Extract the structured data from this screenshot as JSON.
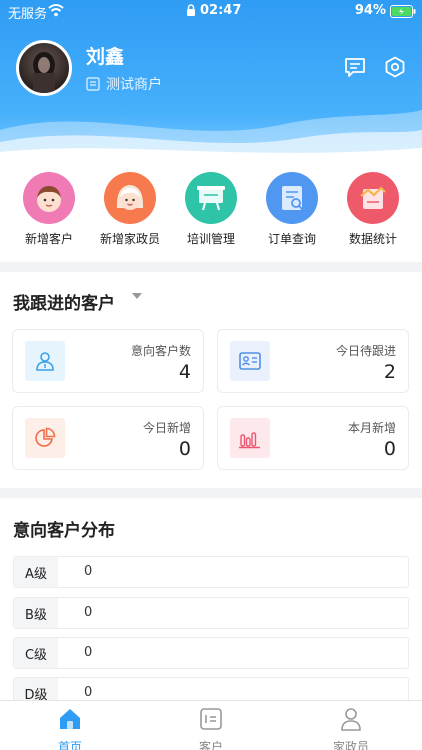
{
  "status_bar": {
    "carrier": "无服务",
    "time": "02:47",
    "battery": "94%"
  },
  "header": {
    "username": "刘鑫",
    "merchant": "测试商户"
  },
  "shortcuts": [
    {
      "label": "新增客户",
      "color": "#f07bb4"
    },
    {
      "label": "新增家政员",
      "color": "#f77a4e"
    },
    {
      "label": "培训管理",
      "color": "#2fc3a8"
    },
    {
      "label": "订单查询",
      "color": "#4f97f1"
    },
    {
      "label": "数据统计",
      "color": "#ef5a6a"
    }
  ],
  "my_customers": {
    "title": "我跟进的客户",
    "stats": [
      {
        "label": "意向客户数",
        "value": "4"
      },
      {
        "label": "今日待跟进",
        "value": "2"
      },
      {
        "label": "今日新增",
        "value": "0"
      },
      {
        "label": "本月新增",
        "value": "0"
      }
    ]
  },
  "distribution": {
    "title": "意向客户分布",
    "rows": [
      {
        "label": "A级",
        "value": "0"
      },
      {
        "label": "B级",
        "value": "0"
      },
      {
        "label": "C级",
        "value": "0"
      },
      {
        "label": "D级",
        "value": "0"
      }
    ]
  },
  "tabbar": {
    "tabs": [
      {
        "label": "首页"
      },
      {
        "label": "客户"
      },
      {
        "label": "家政员"
      }
    ],
    "active_color": "#2f9cf4",
    "inactive_color": "#888888"
  }
}
